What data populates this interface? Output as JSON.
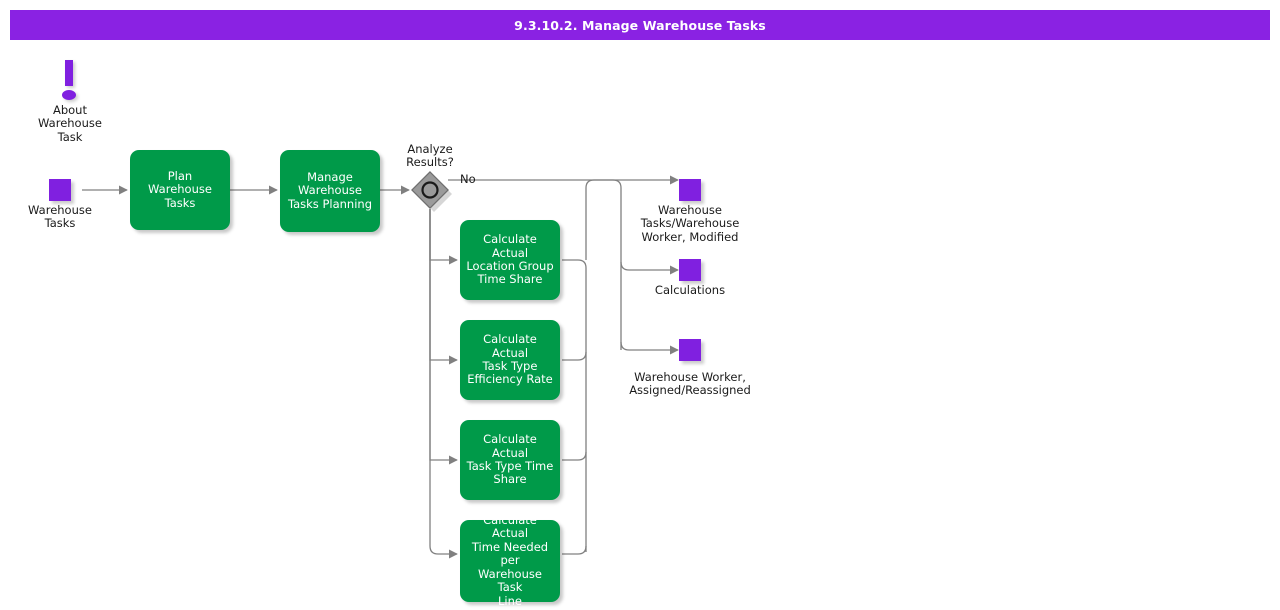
{
  "header": {
    "title": "9.3.10.2. Manage Warehouse Tasks"
  },
  "theme": {
    "banner_color": "#8a22e3",
    "task_color": "#009a49",
    "data_object_color": "#8020e0",
    "connector_color": "#808080",
    "gateway_fill": "#9a9a9a",
    "text_color": "#1a1a1a"
  },
  "diagram": {
    "type": "bpmn-process-flow",
    "notes": [
      {
        "id": "about-warehouse-task",
        "icon": "exclamation-icon",
        "label": "About\nWarehouse\nTask"
      }
    ],
    "data_objects": [
      {
        "id": "warehouse-tasks-input",
        "label": "Warehouse\nTasks",
        "role": "input"
      },
      {
        "id": "warehouse-tasks-warehouse-worker-modified",
        "label": "Warehouse\nTasks/Warehouse\nWorker, Modified",
        "role": "output"
      },
      {
        "id": "calculations",
        "label": "Calculations",
        "role": "output"
      },
      {
        "id": "warehouse-worker-assigned-reassigned",
        "label": "Warehouse Worker,\nAssigned/Reassigned",
        "role": "output"
      }
    ],
    "tasks": [
      {
        "id": "plan-warehouse-tasks",
        "label": "Plan\nWarehouse\nTasks"
      },
      {
        "id": "manage-warehouse-tasks-planning",
        "label": "Manage\nWarehouse\nTasks Planning"
      },
      {
        "id": "calculate-actual-location-group-time-share",
        "label": "Calculate Actual\nLocation Group\nTime Share"
      },
      {
        "id": "calculate-actual-task-type-efficiency-rate",
        "label": "Calculate Actual\nTask Type\nEfficiency Rate"
      },
      {
        "id": "calculate-actual-task-type-time-share",
        "label": "Calculate Actual\nTask Type Time\nShare"
      },
      {
        "id": "calculate-actual-time-needed-per-warehouse-task-line",
        "label": "Calculate Actual\nTime Needed per\nWarehouse Task\nLine"
      }
    ],
    "gateways": [
      {
        "id": "analyze-results",
        "label": "Analyze\nResults?",
        "kind": "event-based-gateway"
      }
    ],
    "flow_labels": [
      {
        "id": "no-branch",
        "label": "No"
      }
    ]
  }
}
